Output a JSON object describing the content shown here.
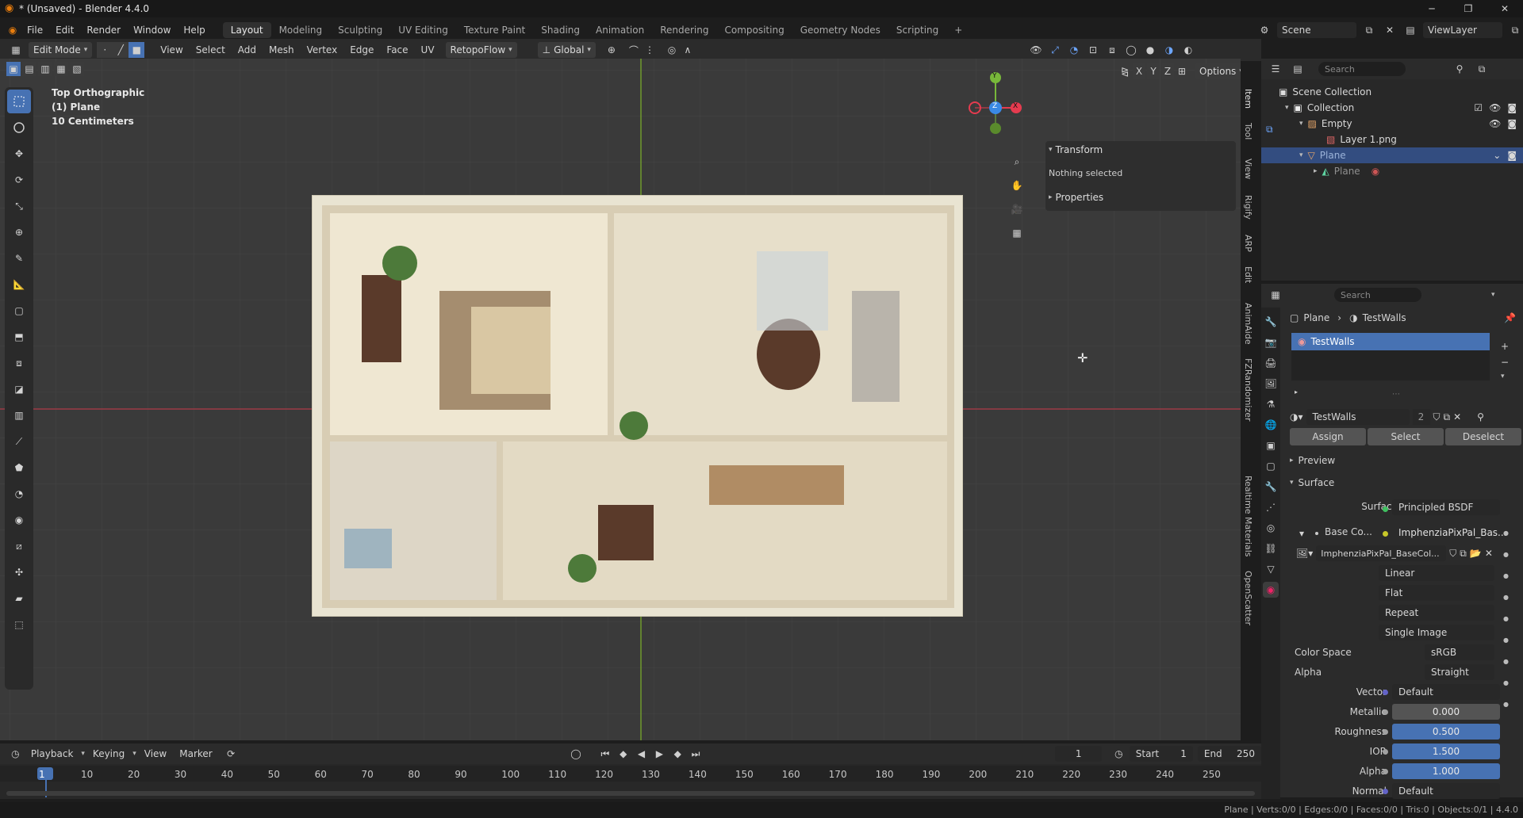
{
  "window": {
    "title": "* (Unsaved) - Blender 4.4.0"
  },
  "menus": [
    "File",
    "Edit",
    "Render",
    "Window",
    "Help"
  ],
  "workspaces": [
    "Layout",
    "Modeling",
    "Sculpting",
    "UV Editing",
    "Texture Paint",
    "Shading",
    "Animation",
    "Rendering",
    "Compositing",
    "Geometry Nodes",
    "Scripting"
  ],
  "active_workspace": "Layout",
  "scene": {
    "name": "Scene",
    "view_layer": "ViewLayer"
  },
  "viewport_header": {
    "mode": "Edit Mode",
    "menus": [
      "View",
      "Select",
      "Add",
      "Mesh",
      "Vertex",
      "Edge",
      "Face",
      "UV"
    ],
    "addon_menu": "RetopoFlow",
    "orientation": "Global",
    "options": "Options",
    "axes": [
      "X",
      "Y",
      "Z"
    ]
  },
  "viewport_overlay": {
    "view_name": "Top Orthographic",
    "object": "(1) Plane",
    "scale": "10 Centimeters"
  },
  "gizmo": {
    "y": "Y",
    "z": "Z",
    "x": "X"
  },
  "n_panel": {
    "transform_header": "Transform",
    "transform_text": "Nothing selected",
    "properties_header": "Properties"
  },
  "side_tabs": [
    "Item",
    "Tool",
    "View",
    "Rigify",
    "ARP",
    "Edit",
    "AnimAide",
    "FZRandomizer",
    "Realtime Materials",
    "OpenScatter"
  ],
  "outliner": {
    "search_placeholder": "Search",
    "root": "Scene Collection",
    "collection": "Collection",
    "empty": "Empty",
    "layer": "Layer 1.png",
    "plane": "Plane",
    "plane_mesh": "Plane"
  },
  "properties": {
    "search_placeholder": "Search",
    "breadcrumb_object": "Plane",
    "breadcrumb_material": "TestWalls",
    "slot_name": "TestWalls",
    "material_name": "TestWalls",
    "users": "2",
    "assign": "Assign",
    "select": "Select",
    "deselect": "Deselect",
    "preview": "Preview",
    "surface_header": "Surface",
    "surface_label": "Surface",
    "surface_value": "Principled BSDF",
    "base_color_label": "Base Co...",
    "base_color_value": "ImphenziaPixPal_Bas...",
    "image_name": "ImphenziaPixPal_BaseCol...",
    "interpolation": "Linear",
    "projection": "Flat",
    "extension": "Repeat",
    "source": "Single Image",
    "color_space_label": "Color Space",
    "color_space": "sRGB",
    "alpha_mode_label": "Alpha",
    "alpha_mode": "Straight",
    "vector_label": "Vector",
    "vector": "Default",
    "metallic_label": "Metallic",
    "metallic": "0.000",
    "roughness_label": "Roughness",
    "roughness": "0.500",
    "ior_label": "IOR",
    "ior": "1.500",
    "alpha_label": "Alpha",
    "alpha": "1.000",
    "normal_label": "Normal",
    "normal": "Default"
  },
  "timeline": {
    "menus": [
      "Playback",
      "Keying",
      "View",
      "Marker"
    ],
    "current_frame": "1",
    "start_label": "Start",
    "start": "1",
    "end_label": "End",
    "end": "250",
    "ticks": [
      "1",
      "10",
      "20",
      "30",
      "40",
      "50",
      "60",
      "70",
      "80",
      "90",
      "100",
      "110",
      "120",
      "130",
      "140",
      "150",
      "160",
      "170",
      "180",
      "190",
      "200",
      "210",
      "220",
      "230",
      "240",
      "250"
    ]
  },
  "status": {
    "text": "Plane | Verts:0/0 | Edges:0/0 | Faces:0/0 | Tris:0 | Objects:0/1 | 4.4.0"
  },
  "colors": {
    "accent": "#4772b3",
    "selection": "#334d80",
    "x_axis": "#e53b4f",
    "y_axis": "#78b83a",
    "z_axis": "#3a89e5"
  }
}
